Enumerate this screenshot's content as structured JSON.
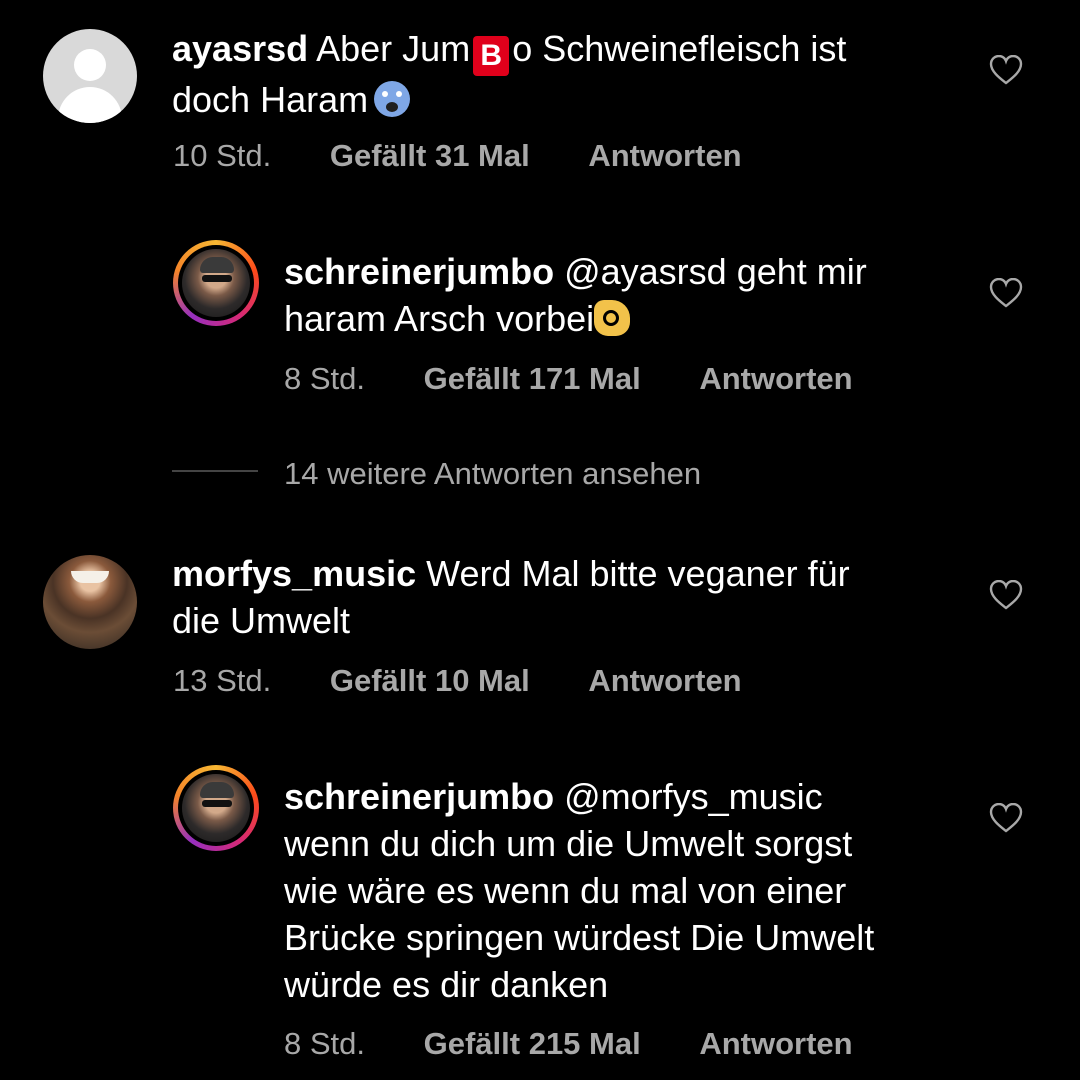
{
  "comments": [
    {
      "username": "ayasrsd",
      "text_before": "Aber Jum",
      "emoji_b": "🅱",
      "text_after": "o Schweinefleisch ist",
      "line2": "doch Haram",
      "emoji": "😱",
      "time": "10 Std.",
      "likes": "Gefällt 31 Mal",
      "reply_label": "Antworten",
      "replies": [
        {
          "username": "schreinerjumbo",
          "mention": "@ayasrsd",
          "line1_rest": "geht mir",
          "line2": "haram Arsch vorbei",
          "emoji": "👌",
          "time": "8 Std.",
          "likes": "Gefällt 171 Mal",
          "reply_label": "Antworten"
        }
      ],
      "more_replies": "14 weitere Antworten ansehen"
    },
    {
      "username": "morfys_music",
      "line1_rest": "Werd Mal bitte veganer für",
      "line2": "die Umwelt",
      "time": "13 Std.",
      "likes": "Gefällt 10 Mal",
      "reply_label": "Antworten",
      "replies": [
        {
          "username": "schreinerjumbo",
          "mention": "@morfys_music",
          "lines": [
            "wenn du dich um die Umwelt sorgst",
            "wie wäre es wenn du mal von einer",
            "Brücke springen würdest Die Umwelt",
            "würde es dir danken"
          ],
          "time": "8 Std.",
          "likes": "Gefällt 215 Mal",
          "reply_label": "Antworten"
        }
      ]
    }
  ],
  "icons": {
    "like": "heart-outline-icon",
    "default_avatar": "person-icon"
  },
  "colors": {
    "background": "#000000",
    "text": "#ffffff",
    "secondary": "#a8a8a8"
  }
}
